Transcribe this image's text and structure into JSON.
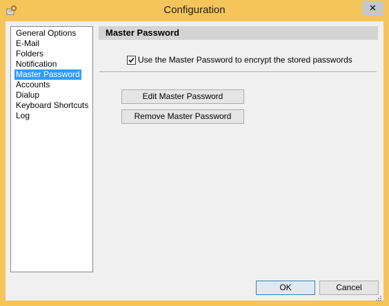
{
  "window": {
    "title": "Configuration",
    "close_glyph": "✕",
    "app_icon": "settings-app-icon",
    "frame_color": "#f5c45b"
  },
  "nav": {
    "items": [
      {
        "label": "General Options",
        "selected": false
      },
      {
        "label": "E-Mail",
        "selected": false
      },
      {
        "label": "Folders",
        "selected": false
      },
      {
        "label": "Notification",
        "selected": false
      },
      {
        "label": "Master Password",
        "selected": true
      },
      {
        "label": "Accounts",
        "selected": false
      },
      {
        "label": "Dialup",
        "selected": false
      },
      {
        "label": "Keyboard Shortcuts",
        "selected": false
      },
      {
        "label": "Log",
        "selected": false
      }
    ],
    "selection_color": "#3399ff"
  },
  "panel": {
    "title": "Master Password",
    "use_master_checkbox": {
      "label": "Use the Master Password to encrypt the stored passwords",
      "checked": true
    },
    "edit_button_label": "Edit Master Password",
    "remove_button_label": "Remove Master Password"
  },
  "footer": {
    "ok_label": "OK",
    "cancel_label": "Cancel"
  }
}
